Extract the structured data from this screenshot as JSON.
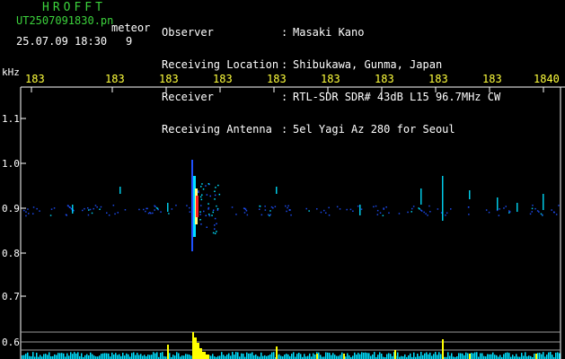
{
  "header": {
    "title": "HROFFT",
    "filename": "UT2507091830.pn",
    "meteor_label": "meteor",
    "datetime": "25.07.09 18:30",
    "count": "9",
    "meta_labels": [
      "Observer",
      "Receiving Location",
      "Receiver",
      "Receiving Antenna"
    ],
    "meta_sep": [
      ":",
      ":",
      ":",
      ":"
    ],
    "meta_values": [
      "Masaki Kano",
      "Shibukawa, Gunma, Japan",
      "RTL-SDR SDR# 43dB L15 96.7MHz CW",
      "5el Yagi Az 280 for Seoul"
    ]
  },
  "axes": {
    "unit": "kHz",
    "x_ticks": [
      "183",
      "183",
      "183",
      "183",
      "183",
      "183",
      "183",
      "183",
      "183",
      "1840"
    ],
    "y_ticks": [
      "1.1",
      "1.0",
      "0.9",
      "0.8",
      "0.7",
      "0.6"
    ]
  },
  "colors": {
    "text_green": "#3cd23c",
    "tick_yellow": "#ffff3c",
    "signal_blue": "#1e50ff",
    "signal_cyan": "#00e0ff",
    "signal_red": "#ff2020",
    "amplitude_yellow": "#ffff00",
    "background": "#000000"
  }
}
